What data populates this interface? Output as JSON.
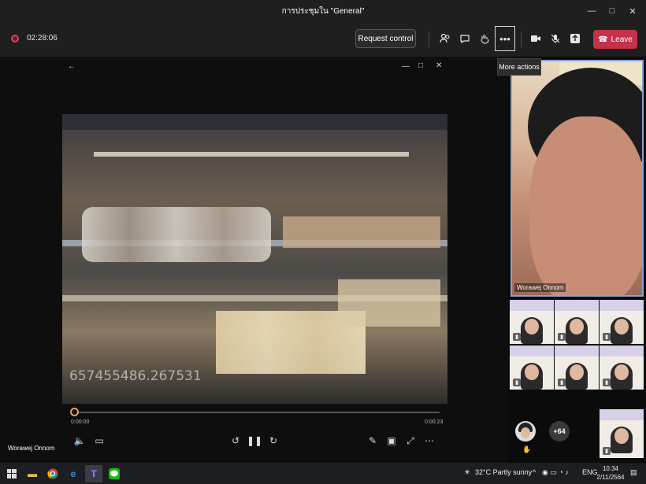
{
  "window": {
    "title": "การประชุมใน \"General\"",
    "minimize": "—",
    "maximize": "□",
    "close": "✕"
  },
  "toolbar": {
    "timer": "02:28:06",
    "request_control": "Request control",
    "leave_label": "Leave",
    "more_actions_tooltip": "More actions",
    "icons": [
      "participants-icon",
      "chat-icon",
      "raise-hand-icon",
      "more-icon",
      "camera-icon",
      "mic-off-icon",
      "share-icon"
    ]
  },
  "viewer": {
    "back": "←",
    "watermark": "657455486.267531",
    "time_current": "0:00:00",
    "time_total": "0:00:23",
    "progress": 0.0
  },
  "presenter": {
    "name": "Worawej Onnom"
  },
  "participants": {
    "main_name": "Worawej Onnom",
    "overflow_count": "+64"
  },
  "taskbar": {
    "weather": "32°C  Partly sunny",
    "language": "ENG",
    "time": "10:34",
    "date": "2/11/2564"
  },
  "colors": {
    "leave": "#c4314b",
    "accent": "#8aa3d8",
    "background": "#0b0b0b"
  }
}
